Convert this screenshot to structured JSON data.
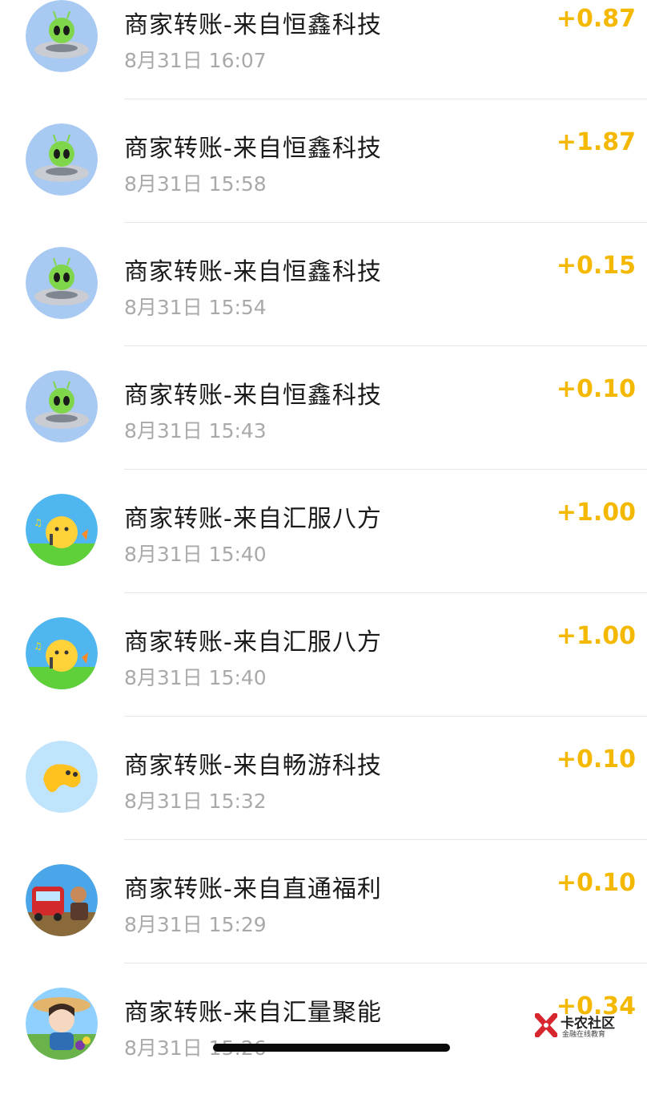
{
  "transactions": [
    {
      "title": "商家转账-来自恒鑫科技",
      "time": "8月31日 16:07",
      "amount": "+0.87",
      "avatar": "ufo-alien-icon"
    },
    {
      "title": "商家转账-来自恒鑫科技",
      "time": "8月31日 15:58",
      "amount": "+1.87",
      "avatar": "ufo-alien-icon"
    },
    {
      "title": "商家转账-来自恒鑫科技",
      "time": "8月31日 15:54",
      "amount": "+0.15",
      "avatar": "ufo-alien-icon"
    },
    {
      "title": "商家转账-来自恒鑫科技",
      "time": "8月31日 15:43",
      "amount": "+0.10",
      "avatar": "ufo-alien-icon"
    },
    {
      "title": "商家转账-来自汇服八方",
      "time": "8月31日 15:40",
      "amount": "+1.00",
      "avatar": "singing-chick-icon"
    },
    {
      "title": "商家转账-来自汇服八方",
      "time": "8月31日 15:40",
      "amount": "+1.00",
      "avatar": "singing-chick-icon"
    },
    {
      "title": "商家转账-来自畅游科技",
      "time": "8月31日 15:32",
      "amount": "+0.10",
      "avatar": "yellow-bean-icon"
    },
    {
      "title": "商家转账-来自直通福利",
      "time": "8月31日 15:29",
      "amount": "+0.10",
      "avatar": "bus-travel-icon"
    },
    {
      "title": "商家转账-来自汇量聚能",
      "time": "8月31日 15:26",
      "amount": "+0.34",
      "avatar": "farmer-girl-icon"
    }
  ],
  "watermark": {
    "title": "卡农社区",
    "subtitle": "金融在线教育"
  },
  "colors": {
    "amount": "#f5b800",
    "title": "#1a1a1a",
    "time": "#a9a9a9",
    "divider": "#e6e6e6"
  }
}
